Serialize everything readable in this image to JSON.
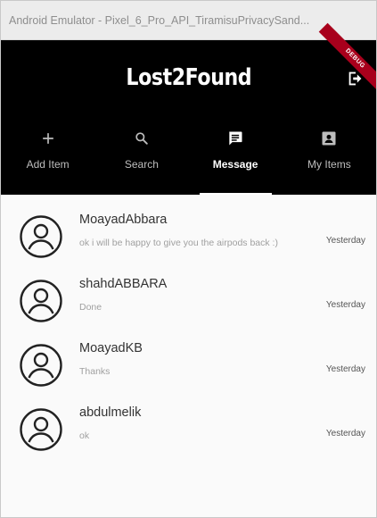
{
  "window": {
    "title": "Android Emulator - Pixel_6_Pro_API_TiramisuPrivacySand..."
  },
  "appbar": {
    "title": "Lost2Found",
    "debug_banner": "DEBUG",
    "logout_icon": "logout-icon"
  },
  "tabs": [
    {
      "label": "Add Item",
      "icon": "plus-icon",
      "active": false
    },
    {
      "label": "Search",
      "icon": "search-icon",
      "active": false
    },
    {
      "label": "Message",
      "icon": "message-icon",
      "active": true
    },
    {
      "label": "My Items",
      "icon": "account-box-icon",
      "active": false
    }
  ],
  "conversations": [
    {
      "name": "MoayadAbbara",
      "preview": "ok i will be happy to give you the airpods back :)",
      "time": "Yesterday"
    },
    {
      "name": "shahdABBARA",
      "preview": "Done",
      "time": "Yesterday"
    },
    {
      "name": "MoayadKB",
      "preview": "Thanks",
      "time": "Yesterday"
    },
    {
      "name": "abdulmelik",
      "preview": "ok",
      "time": "Yesterday"
    }
  ],
  "colors": {
    "appbar_bg": "#000000",
    "active_tab": "#ffffff",
    "inactive_tab": "#bdbdbd",
    "debug_ribbon": "#a8001c"
  }
}
